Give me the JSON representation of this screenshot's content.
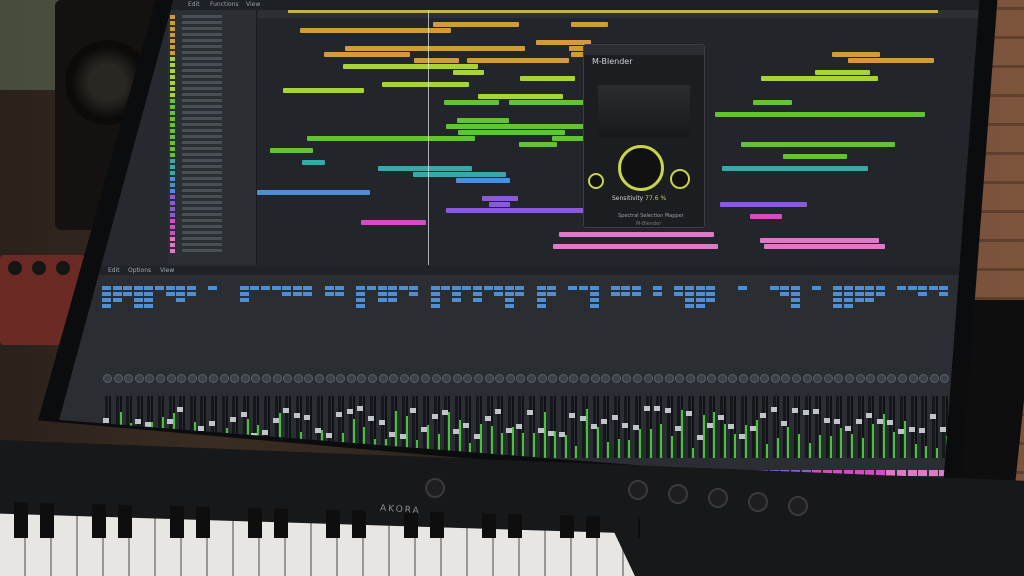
{
  "app": {
    "control_bar_labels": [
      "Edit",
      "Functions",
      "View"
    ],
    "brand": "AKORA"
  },
  "colors": {
    "accent": "#c9d44a",
    "orange": "#d39a3a",
    "green": "#63c236",
    "lime": "#a8d33b",
    "blue": "#4d8fd6",
    "purple": "#8b5bd6",
    "magenta": "#d44ac9",
    "teal": "#3aa8a8",
    "pink": "#e078c8"
  },
  "plugin": {
    "name": "M-Blender",
    "sensitivity_label": "Sensitivity",
    "sensitivity_value": "77.6 %",
    "footer": "Spectral Selection Mapper",
    "sub": "M-Blender"
  },
  "mixer": {
    "bar_labels": [
      "Edit",
      "Options",
      "View"
    ],
    "strip_count": 80
  }
}
